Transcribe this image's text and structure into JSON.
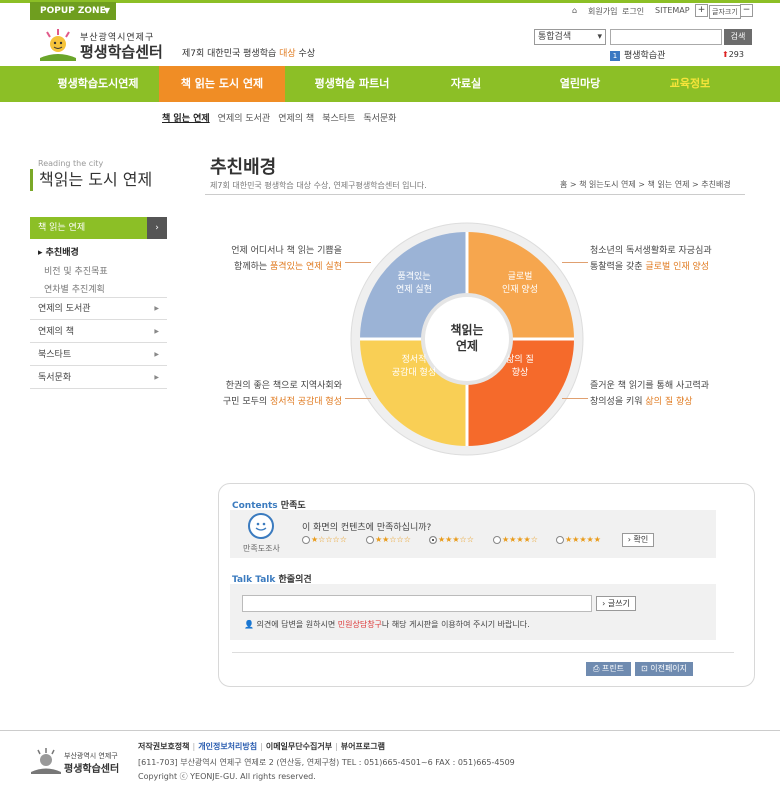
{
  "top": {
    "popup_zone": "POPUP ZONE",
    "links": [
      "회원가입",
      "로그인",
      "SITEMAP"
    ],
    "font_size_label": "글자크기",
    "plus": "+",
    "minus": "−"
  },
  "header": {
    "logo_small": "부산광역시연제구",
    "logo_big": "평생학습센터",
    "slogan_prefix": "제7회 대한민국 평생학습 ",
    "slogan_highlight": "대상",
    "slogan_suffix": " 수상",
    "search_select": "통합검색",
    "search_button": "검색",
    "keyword_rank": "1",
    "keyword": "평생학습관",
    "keyword_count": "293"
  },
  "gnb": [
    "평생학습도시연제",
    "책 읽는 도시 연제",
    "평생학습 파트너",
    "자료실",
    "열린마당",
    "교육정보"
  ],
  "subnav": [
    "책 읽는 연제",
    "연제의 도서관",
    "연제의 책",
    "북스타트",
    "독서문화"
  ],
  "sidebar": {
    "en": "Reading the city",
    "title": "책읽는 도시 연제",
    "head": "책 읽는 연제",
    "subs": [
      "추친배경",
      "비전 및 추진목표",
      "연차별 추진계획"
    ],
    "menus": [
      "연제의 도서관",
      "연제의 책",
      "북스타트",
      "독서문화"
    ]
  },
  "page": {
    "title": "추친배경",
    "desc": "제7회 대한민국 평생학습 대상 수상, 연제구평생학습센터 입니다.",
    "breadcrumb": "홈 > 책 읽는도시 연제 > 책 읽는 연제 > 추친배경"
  },
  "diagram": {
    "center": [
      "책읽는",
      "연제"
    ],
    "q1": [
      "품격있는",
      "연제 실현"
    ],
    "q2": [
      "글로벌",
      "인재 양성"
    ],
    "q3": [
      "정서적",
      "공감대 형성"
    ],
    "q4": [
      "삶의 질",
      "향상"
    ],
    "colors": {
      "q1": "#9bb3d6",
      "q2": "#f6a64e",
      "q3": "#f9cf55",
      "q4": "#f56a2b"
    },
    "callout_tl_1": "언제 어디서나 책 읽는 기쁨을",
    "callout_tl_2a": "함께하는 ",
    "callout_tl_2b": "품격있는 연제 실현",
    "callout_tr_1": "청소년의 독서생활화로 자긍심과",
    "callout_tr_2a": "통찰력을 갖춘 ",
    "callout_tr_2b": "글로벌 인재 양성",
    "callout_bl_1": "한권의 좋은 책으로 지역사회와",
    "callout_bl_2a": "구민 모두의 ",
    "callout_bl_2b": "정서적 공감대 형성",
    "callout_br_1": "즐거운 책 읽기를 통해 사고력과",
    "callout_br_2a": "창의성을 키워 ",
    "callout_br_2b": "삶의 질 향상"
  },
  "survey": {
    "h1_en": "Contents",
    "h1": " 만족도",
    "smiley_label": "만족도조사",
    "question": "이 화면의 컨텐츠에 만족하십니까?",
    "ratings": [
      "★☆☆☆☆",
      "★★☆☆☆",
      "★★★☆☆",
      "★★★★☆",
      "★★★★★"
    ],
    "selected": 3,
    "ok": "확인",
    "h2_en": "Talk Talk",
    "h2": " 한줄의견",
    "write": "글쓰기",
    "notice_a": "의견에 답변을 원하시면 ",
    "notice_b": "민원상담창구",
    "notice_c": "나 해당 게시판을 이용하여 주시기 바랍니다.",
    "print": "프린트",
    "prev": "이전페이지"
  },
  "footer": {
    "logo_small": "부산광역시 연제구",
    "logo_big": "평생학습센터",
    "link1": "저작권보호정책",
    "link2": "개인정보처리방침",
    "link3": "이메일무단수집거부",
    "link4": "뷰어프로그램",
    "address": "[611-703] 부산광역시 연제구 연제로 2 (연산동, 연제구청)    TEL : 051)665-4501~6  FAX : 051)665-4509",
    "copyright": "Copyright ⓒ YEONJE-GU. All rights reserved."
  }
}
